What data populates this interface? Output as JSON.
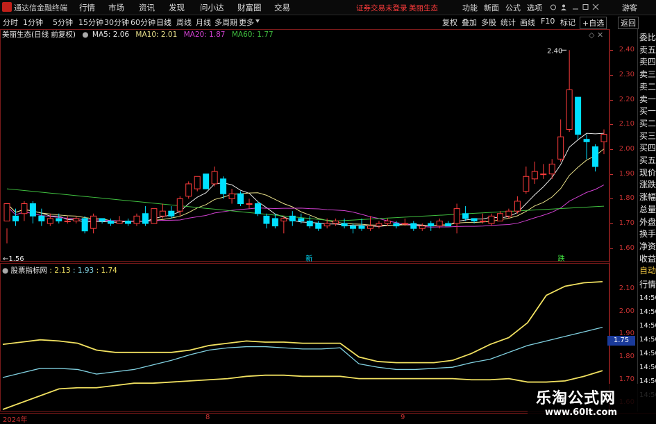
{
  "menubar": {
    "app_title": "通达信金融终端",
    "items": [
      "行情",
      "市场",
      "资讯",
      "发现",
      "问小达",
      "财富圈",
      "交易"
    ],
    "notice": "证券交易未登录",
    "stock": "美丽生态",
    "right_items": [
      "功能",
      "新面",
      "公式",
      "选项"
    ],
    "guest": "游客"
  },
  "periodbar": {
    "tabs": [
      "分时",
      "1分钟",
      "5分钟",
      "15分钟",
      "30分钟",
      "60分钟",
      "日线",
      "周线",
      "月线",
      "多周期",
      "更多"
    ],
    "active": "日线",
    "buttons": [
      "复权",
      "叠加",
      "多股",
      "统计",
      "画线",
      "F10",
      "标记",
      "+自选",
      "返回"
    ]
  },
  "legend": {
    "title": "美丽生态(日线 前复权)",
    "ma": [
      {
        "label": "MA5: 2.06",
        "color": "#e8e8e8"
      },
      {
        "label": "MA10: 2.01",
        "color": "#e8e08a"
      },
      {
        "label": "MA20: 1.87",
        "color": "#d040d0"
      },
      {
        "label": "MA60: 1.77",
        "color": "#40c040"
      }
    ]
  },
  "sub_legend": {
    "title": "股票指标网",
    "values": [
      {
        "label": ": 2.13",
        "color": "#f0e060"
      },
      {
        "label": ": 1.93",
        "color": "#80d0e0"
      },
      {
        "label": ": 1.74",
        "color": "#f0e060"
      }
    ]
  },
  "y_axis_main": [
    "2.40",
    "2.30",
    "2.20",
    "2.10",
    "2.00",
    "1.90",
    "1.80",
    "1.70",
    "1.60"
  ],
  "y_axis_sub": [
    "2.10",
    "2.00",
    "1.90",
    "1.80",
    "1.70",
    "1.60"
  ],
  "sub_marker": "1.75",
  "right_column": [
    "委比",
    "卖五",
    "卖四",
    "卖三",
    "卖二",
    "卖一",
    "买一",
    "买二",
    "买三",
    "买四",
    "买五",
    "现价",
    "涨跌",
    "涨幅",
    "总量",
    "外盘",
    "换手",
    "净资",
    "收益"
  ],
  "right_column_sub": [
    "自动",
    "行情",
    "14:50",
    "14:50",
    "14:50",
    "14:50",
    "14:50",
    "14:50",
    "14:50",
    "14:50"
  ],
  "dates": [
    "2024年",
    "8",
    "9"
  ],
  "annotations": {
    "high": "2.40",
    "low": "1.56",
    "low_prefix": "←",
    "buy_label": "新",
    "sell_label": "跌"
  },
  "watermark": {
    "line1": "乐淘公式网",
    "line2": "www.60lt.com"
  },
  "colors": {
    "up": "#ff3c3c",
    "down": "#00e0ff",
    "ma5": "#e8e8e8",
    "ma10": "#e8e08a",
    "ma20": "#d040d0",
    "ma60": "#40c040",
    "axis": "#c83232"
  },
  "chart_data": [
    {
      "type": "candlestick",
      "title": "美丽生态(日线 前复权)",
      "ylim": [
        1.56,
        2.44
      ],
      "candles": [
        [
          1.71,
          1.78,
          1.68,
          1.62
        ],
        [
          1.73,
          1.71,
          1.76,
          1.69
        ],
        [
          1.74,
          1.78,
          1.79,
          1.71
        ],
        [
          1.78,
          1.73,
          1.79,
          1.7
        ],
        [
          1.73,
          1.71,
          1.76,
          1.69
        ],
        [
          1.7,
          1.72,
          1.74,
          1.69
        ],
        [
          1.72,
          1.71,
          1.74,
          1.7
        ],
        [
          1.71,
          1.71,
          1.73,
          1.7
        ],
        [
          1.71,
          1.72,
          1.73,
          1.7
        ],
        [
          1.72,
          1.67,
          1.73,
          1.66
        ],
        [
          1.68,
          1.73,
          1.74,
          1.66
        ],
        [
          1.72,
          1.71,
          1.72,
          1.7
        ],
        [
          1.71,
          1.7,
          1.72,
          1.69
        ],
        [
          1.7,
          1.71,
          1.73,
          1.7
        ],
        [
          1.71,
          1.7,
          1.72,
          1.69
        ],
        [
          1.7,
          1.73,
          1.74,
          1.69
        ],
        [
          1.74,
          1.7,
          1.77,
          1.69
        ],
        [
          1.7,
          1.76,
          1.76,
          1.7
        ],
        [
          1.73,
          1.75,
          1.78,
          1.72
        ],
        [
          1.75,
          1.73,
          1.77,
          1.72
        ],
        [
          1.75,
          1.8,
          1.81,
          1.73
        ],
        [
          1.81,
          1.86,
          1.87,
          1.8
        ],
        [
          1.84,
          1.89,
          1.89,
          1.83
        ],
        [
          1.9,
          1.84,
          1.9,
          1.84
        ],
        [
          1.86,
          1.91,
          1.93,
          1.85
        ],
        [
          1.88,
          1.82,
          1.89,
          1.8
        ],
        [
          1.8,
          1.82,
          1.84,
          1.78
        ],
        [
          1.82,
          1.78,
          1.83,
          1.77
        ],
        [
          1.78,
          1.78,
          1.8,
          1.76
        ],
        [
          1.78,
          1.74,
          1.79,
          1.73
        ],
        [
          1.73,
          1.7,
          1.74,
          1.68
        ],
        [
          1.72,
          1.69,
          1.74,
          1.68
        ],
        [
          1.71,
          1.72,
          1.73,
          1.66
        ],
        [
          1.73,
          1.71,
          1.75,
          1.69
        ],
        [
          1.72,
          1.71,
          1.74,
          1.7
        ],
        [
          1.71,
          1.69,
          1.73,
          1.68
        ],
        [
          1.7,
          1.68,
          1.71,
          1.67
        ],
        [
          1.69,
          1.7,
          1.72,
          1.68
        ],
        [
          1.7,
          1.71,
          1.72,
          1.69
        ],
        [
          1.7,
          1.69,
          1.72,
          1.68
        ],
        [
          1.69,
          1.68,
          1.7,
          1.66
        ],
        [
          1.69,
          1.68,
          1.72,
          1.67
        ],
        [
          1.68,
          1.69,
          1.73,
          1.67
        ],
        [
          1.69,
          1.7,
          1.71,
          1.68
        ],
        [
          1.7,
          1.71,
          1.72,
          1.69
        ],
        [
          1.7,
          1.69,
          1.71,
          1.68
        ],
        [
          1.7,
          1.7,
          1.72,
          1.69
        ],
        [
          1.7,
          1.68,
          1.71,
          1.67
        ],
        [
          1.68,
          1.69,
          1.7,
          1.67
        ],
        [
          1.7,
          1.69,
          1.71,
          1.67
        ],
        [
          1.69,
          1.71,
          1.72,
          1.68
        ],
        [
          1.7,
          1.69,
          1.71,
          1.69
        ],
        [
          1.7,
          1.76,
          1.78,
          1.66
        ],
        [
          1.74,
          1.72,
          1.77,
          1.71
        ],
        [
          1.72,
          1.71,
          1.72,
          1.7
        ],
        [
          1.71,
          1.71,
          1.74,
          1.7
        ],
        [
          1.7,
          1.73,
          1.74,
          1.69
        ],
        [
          1.71,
          1.74,
          1.75,
          1.71
        ],
        [
          1.73,
          1.75,
          1.76,
          1.72
        ],
        [
          1.75,
          1.79,
          1.81,
          1.74
        ],
        [
          1.83,
          1.89,
          1.93,
          1.82
        ],
        [
          1.88,
          1.91,
          1.95,
          1.86
        ],
        [
          1.9,
          1.9,
          1.94,
          1.88
        ],
        [
          1.9,
          1.94,
          1.96,
          1.88
        ],
        [
          1.96,
          2.05,
          2.12,
          1.95
        ],
        [
          2.08,
          2.24,
          2.4,
          2.07
        ],
        [
          2.21,
          2.06,
          2.21,
          2.04
        ],
        [
          2.04,
          2.03,
          2.06,
          1.96
        ],
        [
          2.01,
          1.93,
          2.02,
          1.91
        ],
        [
          2.03,
          2.06,
          2.08,
          1.98
        ]
      ],
      "low_mark": 1.56,
      "high_mark": 2.4
    },
    {
      "type": "line",
      "title": "股票指标网",
      "ylim": [
        1.57,
        2.16
      ],
      "series": [
        {
          "color": "#f0e060",
          "values": [
            1.855,
            1.865,
            1.875,
            1.87,
            1.86,
            1.83,
            1.82,
            1.82,
            1.82,
            1.82,
            1.83,
            1.85,
            1.86,
            1.87,
            1.865,
            1.865,
            1.86,
            1.86,
            1.86,
            1.8,
            1.78,
            1.775,
            1.775,
            1.775,
            1.785,
            1.815,
            1.855,
            1.885,
            1.95,
            2.07,
            2.11,
            2.125,
            2.13
          ]
        },
        {
          "color": "#80d0e0",
          "values": [
            1.71,
            1.73,
            1.75,
            1.75,
            1.745,
            1.725,
            1.735,
            1.745,
            1.765,
            1.785,
            1.81,
            1.83,
            1.84,
            1.845,
            1.845,
            1.84,
            1.835,
            1.835,
            1.84,
            1.77,
            1.755,
            1.745,
            1.745,
            1.75,
            1.755,
            1.775,
            1.79,
            1.82,
            1.85,
            1.87,
            1.89,
            1.91,
            1.93
          ]
        },
        {
          "color": "#f0e060",
          "values": [
            1.57,
            1.6,
            1.63,
            1.66,
            1.665,
            1.665,
            1.675,
            1.685,
            1.685,
            1.69,
            1.695,
            1.7,
            1.705,
            1.715,
            1.72,
            1.72,
            1.715,
            1.715,
            1.715,
            1.705,
            1.705,
            1.705,
            1.705,
            1.705,
            1.705,
            1.7,
            1.7,
            1.705,
            1.69,
            1.69,
            1.695,
            1.715,
            1.74
          ]
        }
      ]
    }
  ]
}
